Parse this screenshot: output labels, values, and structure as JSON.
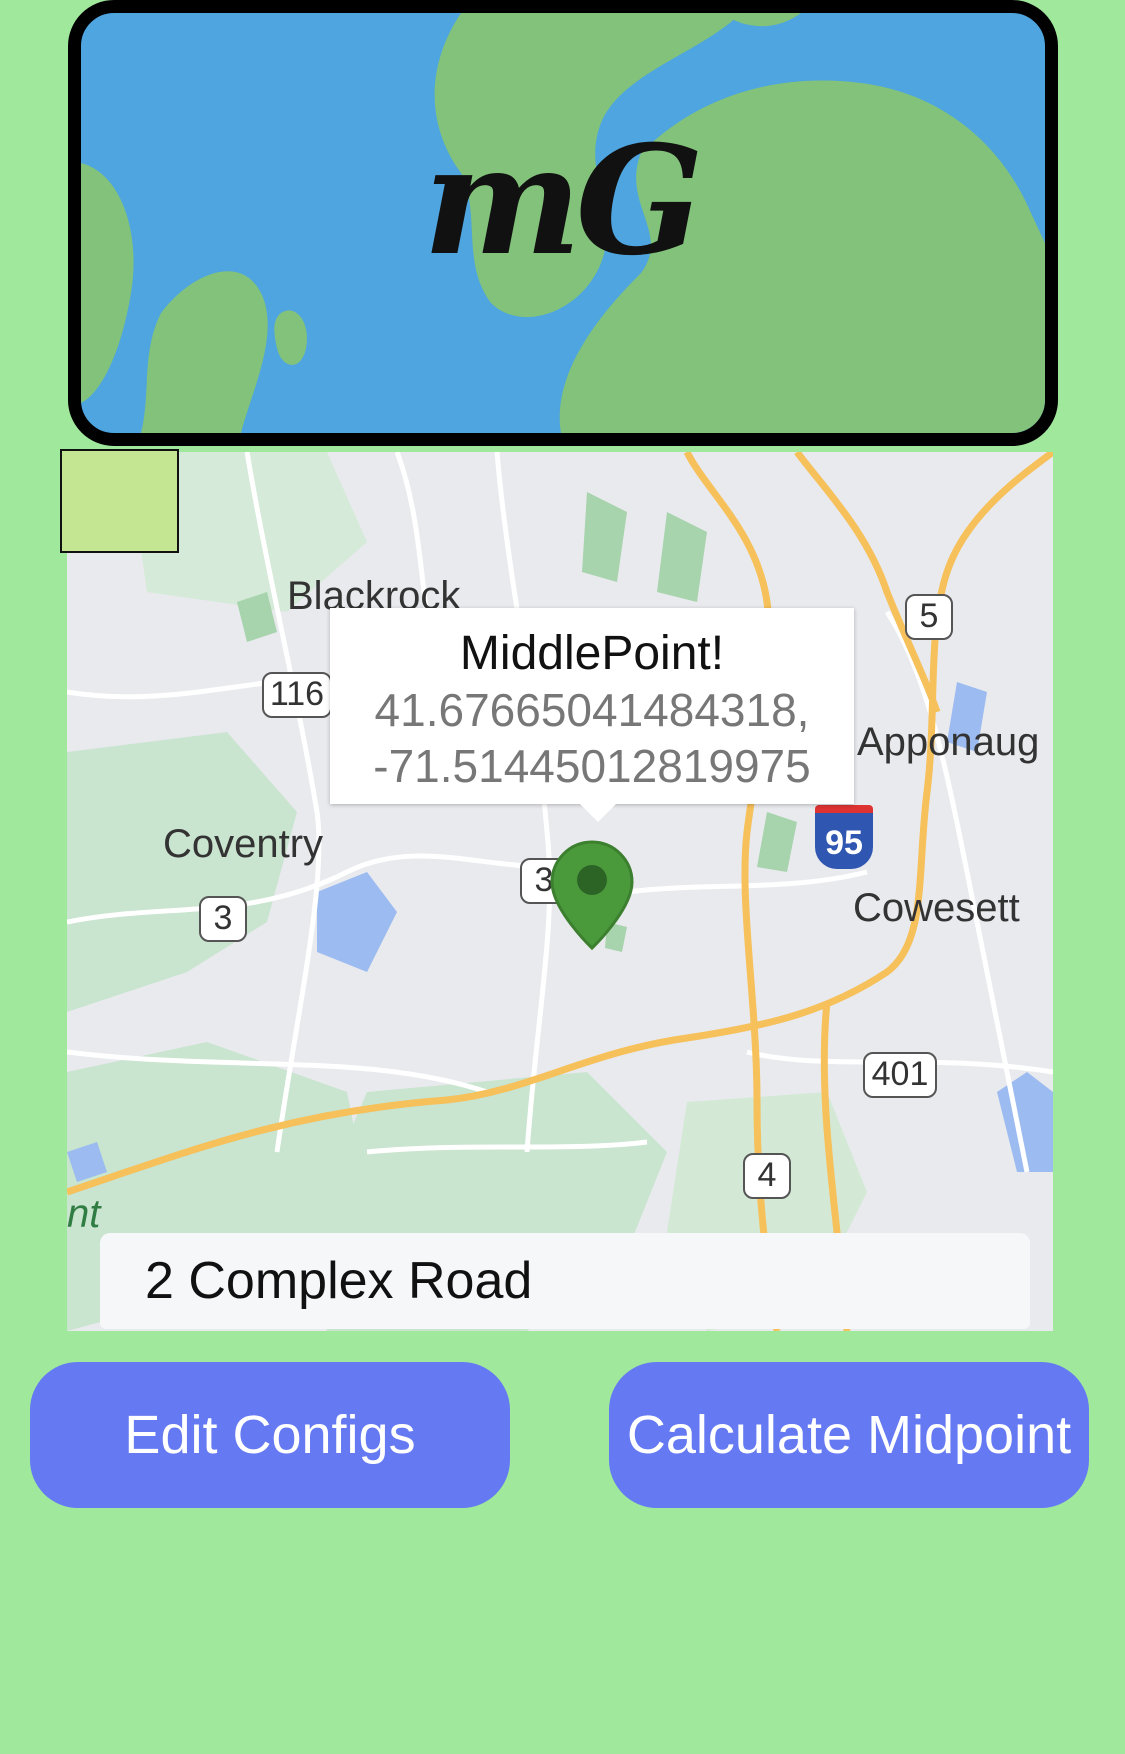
{
  "header": {
    "logo_text": "mG"
  },
  "map": {
    "callout_title": "MiddlePoint!",
    "callout_lat": "41.67665041484318,",
    "callout_lng": "-71.51445012819975",
    "labels": {
      "blackrock": "Blackrock",
      "coventry": "Coventry",
      "apponaug": "Apponaug",
      "cowesett": "Cowesett",
      "partial": "nt"
    },
    "shields": {
      "r116": "116",
      "r3a": "3",
      "r3b": "3",
      "r5": "5",
      "i95": "95",
      "r401": "401",
      "r4": "4"
    }
  },
  "address": {
    "value": "2 Complex Road"
  },
  "buttons": {
    "edit": "Edit Configs",
    "calculate": "Calculate Midpoint"
  },
  "colors": {
    "background": "#a0e89b",
    "button": "#6479f2",
    "marker": "#4a9a3c"
  }
}
